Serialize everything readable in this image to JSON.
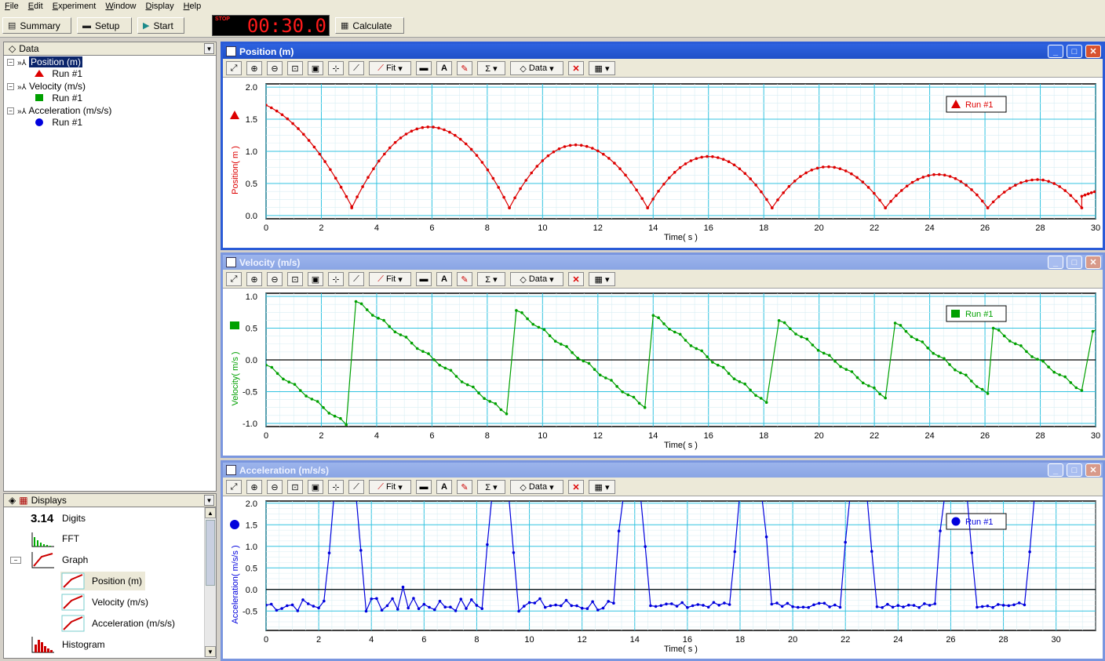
{
  "menu": [
    "File",
    "Edit",
    "Experiment",
    "Window",
    "Display",
    "Help"
  ],
  "toolbar": {
    "summary": "Summary",
    "setup": "Setup",
    "start": "Start",
    "stop_label": "STOP",
    "timer": "00:30.0",
    "calculate": "Calculate"
  },
  "data_panel": {
    "title": "Data",
    "items": [
      {
        "label": "Position (m)",
        "run": "Run #1",
        "marker": "triangle",
        "color": "#dd0000"
      },
      {
        "label": "Velocity (m/s)",
        "run": "Run #1",
        "marker": "square",
        "color": "#00a000"
      },
      {
        "label": "Acceleration (m/s/s)",
        "run": "Run #1",
        "marker": "circle",
        "color": "#0000dd"
      }
    ]
  },
  "displays_panel": {
    "title": "Displays",
    "items": [
      {
        "label": "Digits",
        "icon": "3.14"
      },
      {
        "label": "FFT"
      },
      {
        "label": "Graph"
      },
      {
        "label": "Position (m)"
      },
      {
        "label": "Velocity (m/s)"
      },
      {
        "label": "Acceleration (m/s/s)"
      },
      {
        "label": "Histogram"
      }
    ]
  },
  "graph_toolbar": {
    "fit": "Fit",
    "data": "Data"
  },
  "graphs": [
    {
      "title": "Position (m)",
      "ylabel": "Position( m )",
      "xlabel": "Time( s )",
      "legend": "Run #1",
      "color": "#dd0000",
      "marker": "triangle"
    },
    {
      "title": "Velocity (m/s)",
      "ylabel": "Velocity( m/s )",
      "xlabel": "Time( s )",
      "legend": "Run #1",
      "color": "#00a000",
      "marker": "square"
    },
    {
      "title": "Acceleration (m/s/s)",
      "ylabel": "Acceleration( m/s/s )",
      "xlabel": "Time( s )",
      "legend": "Run #1",
      "color": "#0000dd",
      "marker": "circle"
    }
  ],
  "chart_data": [
    {
      "type": "scatter",
      "title": "Position (m)",
      "xlabel": "Time( s )",
      "ylabel": "Position( m )",
      "xlim": [
        0,
        30
      ],
      "ylim": [
        -0.05,
        2.05
      ],
      "xticks": [
        0,
        2,
        4,
        6,
        8,
        10,
        12,
        14,
        16,
        18,
        20,
        22,
        24,
        26,
        28,
        30
      ],
      "yticks": [
        0.0,
        0.5,
        1.0,
        1.5,
        2.0
      ],
      "ytick_labels": [
        "0.0",
        "0.5",
        "1.0",
        "1.5",
        "2.0"
      ],
      "grid": true,
      "legend": "top-right",
      "series": [
        {
          "name": "Run #1",
          "color": "#dd0000",
          "arches": [
            {
              "x0": 0.0,
              "x1": 3.1,
              "peak_t": -1.0,
              "peak": 1.82,
              "end": 0.14
            },
            {
              "x0": 3.1,
              "x1": 8.8,
              "peak_t": 5.9,
              "peak": 1.38,
              "end": 0.12
            },
            {
              "x0": 8.8,
              "x1": 13.8,
              "peak_t": 11.2,
              "peak": 1.1,
              "end": 0.12
            },
            {
              "x0": 13.8,
              "x1": 18.3,
              "peak_t": 16.0,
              "peak": 0.92,
              "end": 0.12
            },
            {
              "x0": 18.3,
              "x1": 22.4,
              "peak_t": 20.3,
              "peak": 0.76,
              "end": 0.12
            },
            {
              "x0": 22.4,
              "x1": 26.1,
              "peak_t": 24.3,
              "peak": 0.64,
              "end": 0.12
            },
            {
              "x0": 26.1,
              "x1": 29.5,
              "peak_t": 27.9,
              "peak": 0.56,
              "end": 0.12
            },
            {
              "x0": 29.5,
              "x1": 30.2,
              "peak_t": 31.2,
              "peak": 0.45,
              "end": 0.3
            }
          ]
        }
      ]
    },
    {
      "type": "scatter",
      "title": "Velocity (m/s)",
      "xlabel": "Time( s )",
      "ylabel": "Velocity( m/s )",
      "xlim": [
        0,
        30
      ],
      "ylim": [
        -1.05,
        1.05
      ],
      "xticks": [
        0,
        2,
        4,
        6,
        8,
        10,
        12,
        14,
        16,
        18,
        20,
        22,
        24,
        26,
        28,
        30
      ],
      "yticks": [
        -1.0,
        -0.5,
        0.0,
        0.5,
        1.0
      ],
      "ytick_labels": [
        "-1.0",
        "-0.5",
        "0.0",
        "0.5",
        "1.0"
      ],
      "zero_line": true,
      "grid": true,
      "legend": "top-right",
      "series": [
        {
          "name": "Run #1",
          "color": "#00a000",
          "segments": [
            {
              "x0": 0.0,
              "x1": 2.9,
              "y0": -0.08,
              "y1": -1.02
            },
            {
              "x0": 3.25,
              "x1": 8.7,
              "y0": 0.92,
              "y1": -0.85
            },
            {
              "x0": 9.05,
              "x1": 13.7,
              "y0": 0.78,
              "y1": -0.75
            },
            {
              "x0": 14.0,
              "x1": 18.1,
              "y0": 0.7,
              "y1": -0.67
            },
            {
              "x0": 18.55,
              "x1": 22.4,
              "y0": 0.62,
              "y1": -0.6
            },
            {
              "x0": 22.75,
              "x1": 26.1,
              "y0": 0.58,
              "y1": -0.53
            },
            {
              "x0": 26.3,
              "x1": 29.5,
              "y0": 0.5,
              "y1": -0.48
            },
            {
              "x0": 29.9,
              "x1": 30.2,
              "y0": 0.45,
              "y1": 0.45
            }
          ]
        }
      ]
    },
    {
      "type": "scatter",
      "title": "Acceleration (m/s/s)",
      "xlabel": "Time( s )",
      "ylabel": "Acceleration( m/s/s )",
      "xlim": [
        0,
        31.5
      ],
      "ylim": [
        -0.95,
        2.05
      ],
      "xticks": [
        0,
        2,
        4,
        6,
        8,
        10,
        12,
        14,
        16,
        18,
        20,
        22,
        24,
        26,
        28,
        30
      ],
      "yticks": [
        -0.5,
        0.0,
        0.5,
        1.0,
        1.5,
        2.0
      ],
      "ytick_labels": [
        "-0.5",
        "0.0",
        "0.5",
        "1.0",
        "1.5",
        "2.0"
      ],
      "zero_line": true,
      "grid": true,
      "legend": "top-right",
      "series": [
        {
          "name": "Run #1",
          "color": "#0000dd",
          "baseline": -0.3,
          "spikes": [
            3.05,
            8.9,
            13.9,
            18.4,
            22.5,
            26.2,
            29.6
          ]
        }
      ]
    }
  ]
}
